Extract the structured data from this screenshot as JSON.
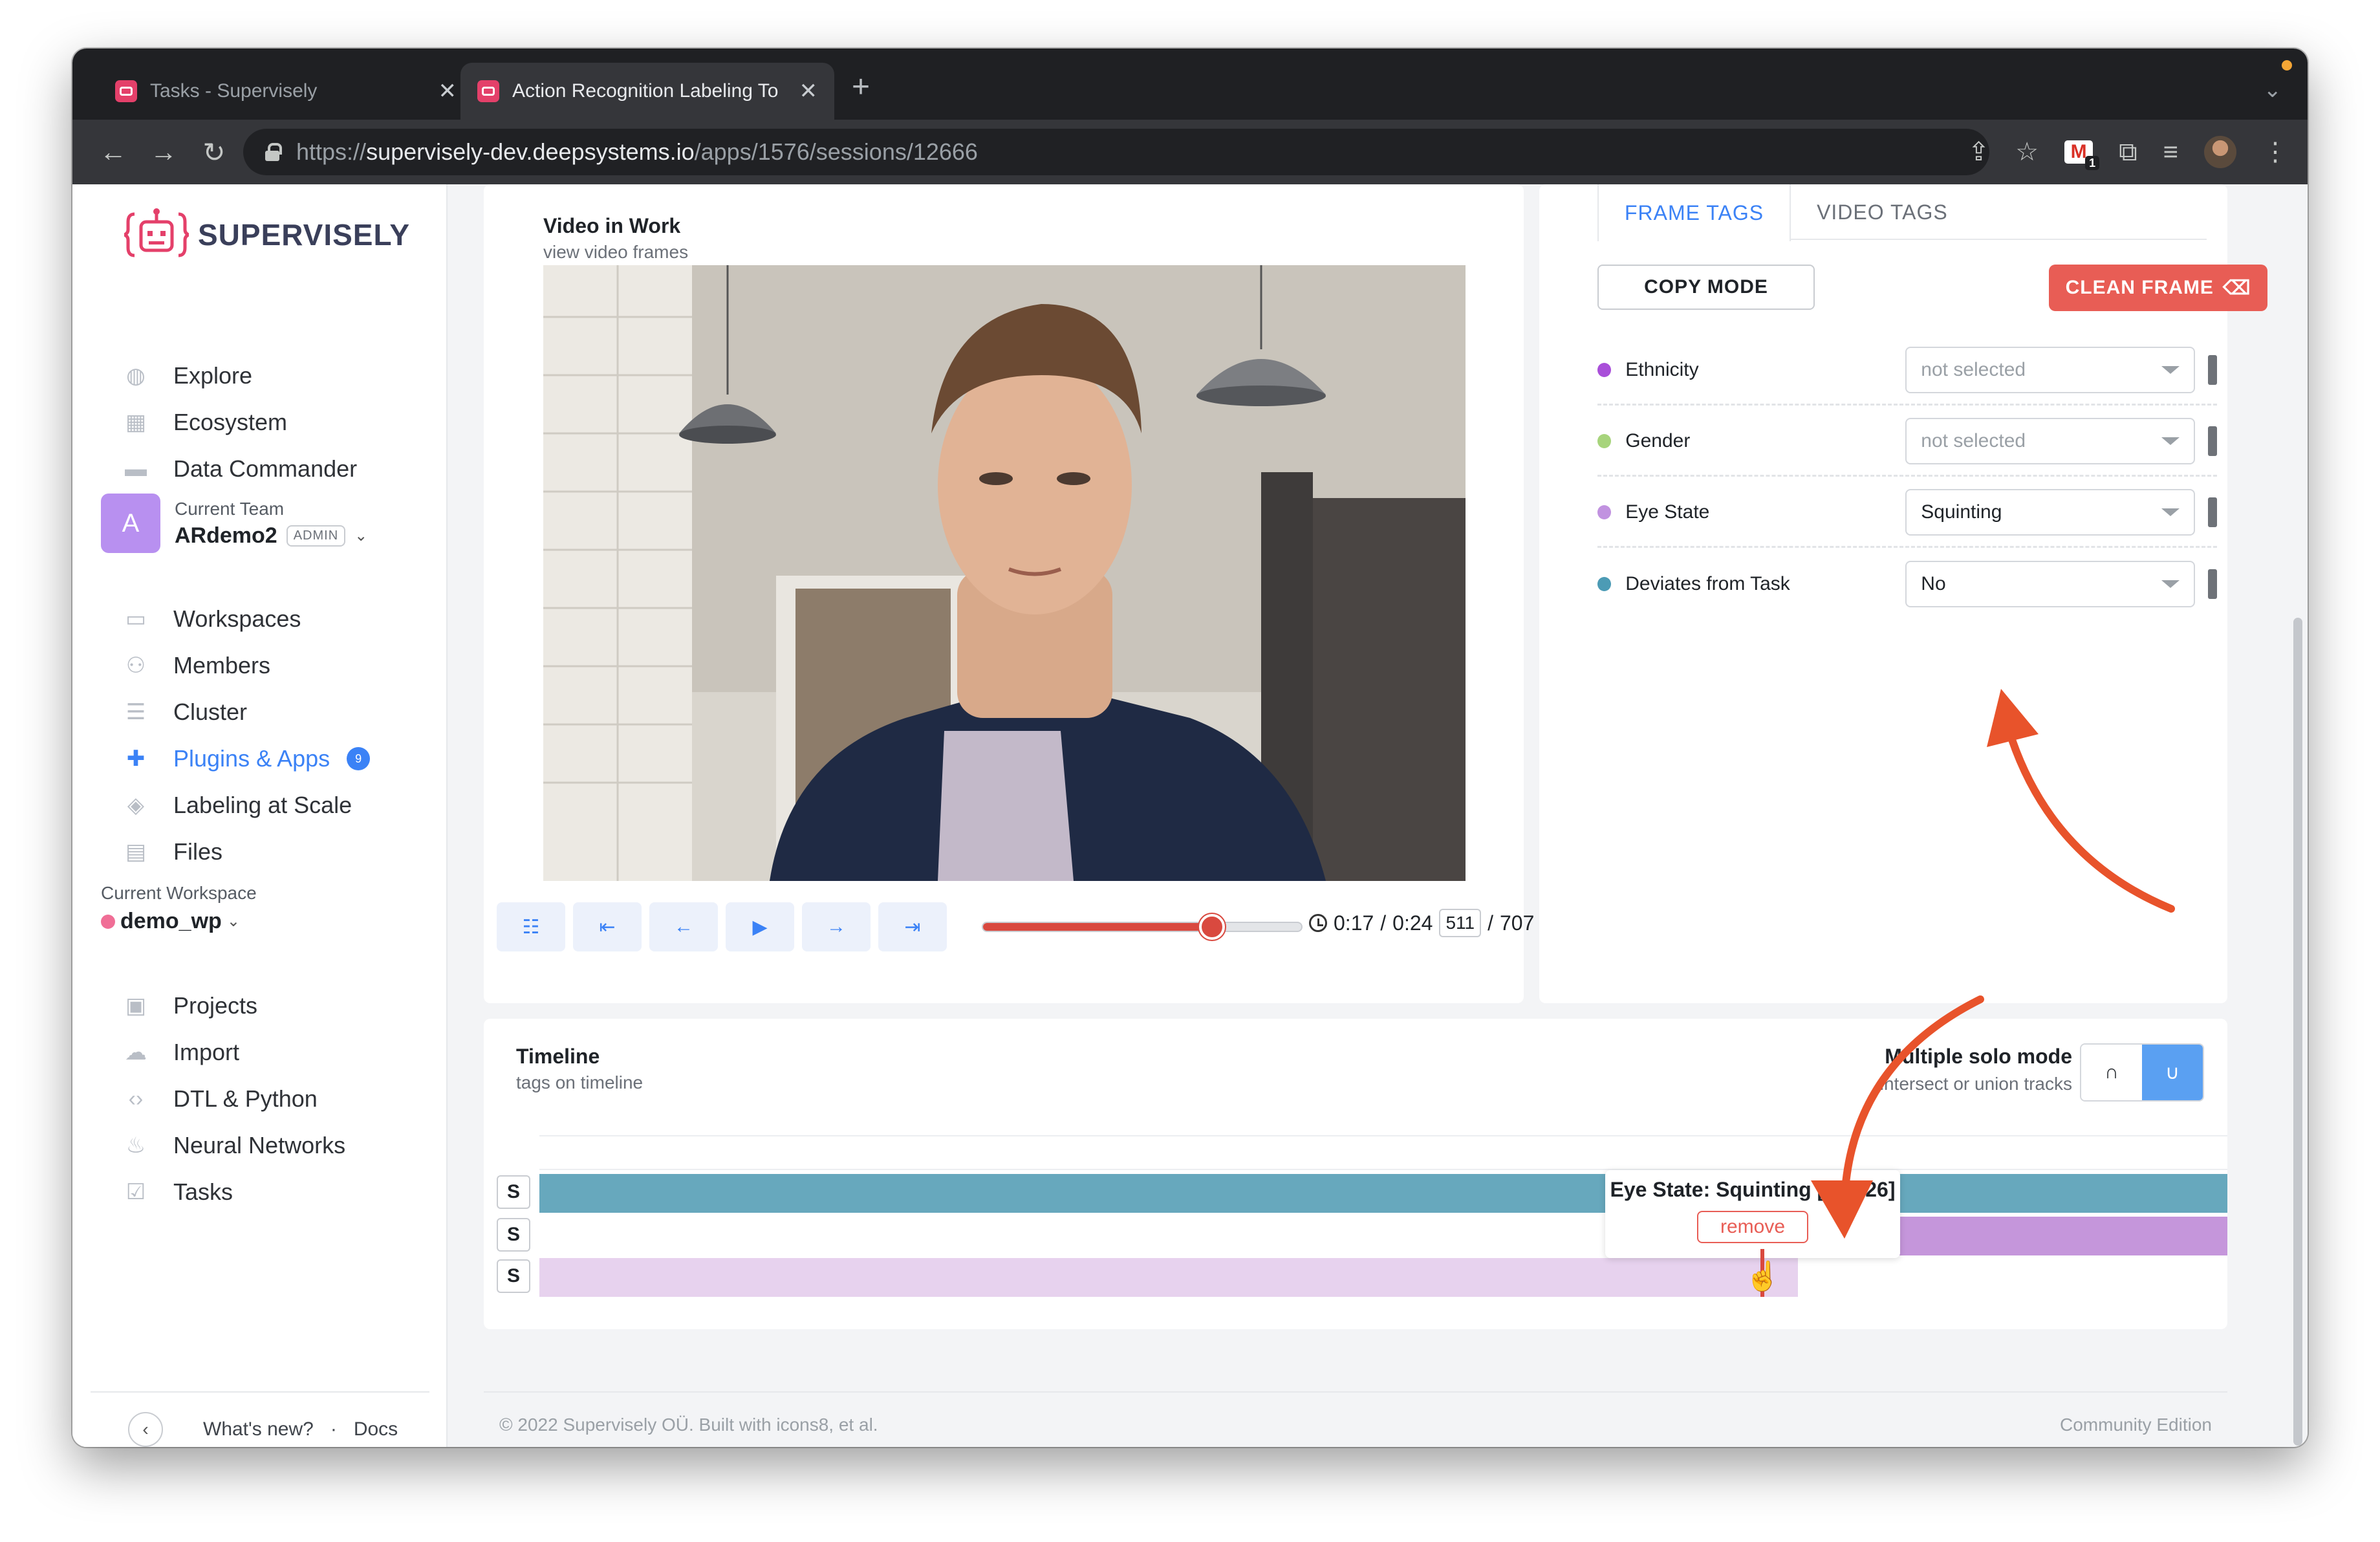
{
  "browser": {
    "tabs": [
      {
        "title": "Tasks - Supervisely",
        "active": false
      },
      {
        "title": "Action Recognition Labeling To",
        "active": true
      }
    ],
    "url_scheme": "https://",
    "url_host": "supervisely-dev.deepsystems.io",
    "url_path": "/apps/1576/sessions/12666",
    "extension_badge": "1"
  },
  "sidebar": {
    "logo_text": "SUPERVISELY",
    "nav_top": [
      {
        "label": "Explore",
        "icon": "globe-icon"
      },
      {
        "label": "Ecosystem",
        "icon": "grid-icon"
      },
      {
        "label": "Data Commander",
        "icon": "folder-icon"
      }
    ],
    "team": {
      "caption": "Current Team",
      "name": "ARdemo2",
      "role": "ADMIN",
      "avatar_letter": "A"
    },
    "nav_team": [
      {
        "label": "Workspaces",
        "icon": "monitor-icon"
      },
      {
        "label": "Members",
        "icon": "users-icon"
      },
      {
        "label": "Cluster",
        "icon": "server-icon"
      },
      {
        "label": "Plugins & Apps",
        "icon": "puzzle-icon",
        "badge": "9",
        "active": true
      },
      {
        "label": "Labeling at Scale",
        "icon": "layers-icon"
      },
      {
        "label": "Files",
        "icon": "file-icon"
      }
    ],
    "workspace": {
      "caption": "Current Workspace",
      "name": "demo_wp"
    },
    "nav_workspace": [
      {
        "label": "Projects",
        "icon": "images-icon"
      },
      {
        "label": "Import",
        "icon": "cloud-upload-icon"
      },
      {
        "label": "DTL & Python",
        "icon": "code-icon"
      },
      {
        "label": "Neural Networks",
        "icon": "flame-icon"
      },
      {
        "label": "Tasks",
        "icon": "clipboard-check-icon"
      }
    ],
    "footer": {
      "whats_new": "What's new?",
      "separator": "·",
      "docs": "Docs"
    }
  },
  "video": {
    "title": "Video in Work",
    "subtitle": "view video frames",
    "time_current": "0:17",
    "time_total": "0:24",
    "frame_current": "511",
    "frame_total": "707",
    "progress": 0.72
  },
  "tags": {
    "tab_frame": "FRAME TAGS",
    "tab_video": "VIDEO TAGS",
    "copy_mode": "COPY MODE",
    "clean_frame": "CLEAN FRAME",
    "rows": [
      {
        "name": "Ethnicity",
        "value": "not selected",
        "placeholder": true,
        "color": "#a94fd9"
      },
      {
        "name": "Gender",
        "value": "not selected",
        "placeholder": true,
        "color": "#a7d47c"
      },
      {
        "name": "Eye State",
        "value": "Squinting",
        "placeholder": false,
        "color": "#c192e0"
      },
      {
        "name": "Deviates from Task",
        "value": "No",
        "placeholder": false,
        "color": "#4c9bb5"
      }
    ]
  },
  "timeline": {
    "title": "Timeline",
    "subtitle": "tags on timeline",
    "solo_title": "Multiple solo mode",
    "solo_sub": "intersect or union tracks",
    "solo_intersect": "∩",
    "solo_union": "∪",
    "solo_button": "S",
    "tooltip_title": "Eye State: Squinting [0 - 526]",
    "tooltip_button": "remove",
    "colors": {
      "track1": "#67a8bd",
      "track2": "#c596db",
      "track3": "#e7d2ee"
    }
  },
  "footer": {
    "copyright": "© 2022 Supervisely OÜ. Built with icons8, et al.",
    "edition": "Community Edition"
  },
  "colors": {
    "accent": "#3b82f6",
    "danger": "#e85d55",
    "annotation_arrow": "#e8532b"
  }
}
